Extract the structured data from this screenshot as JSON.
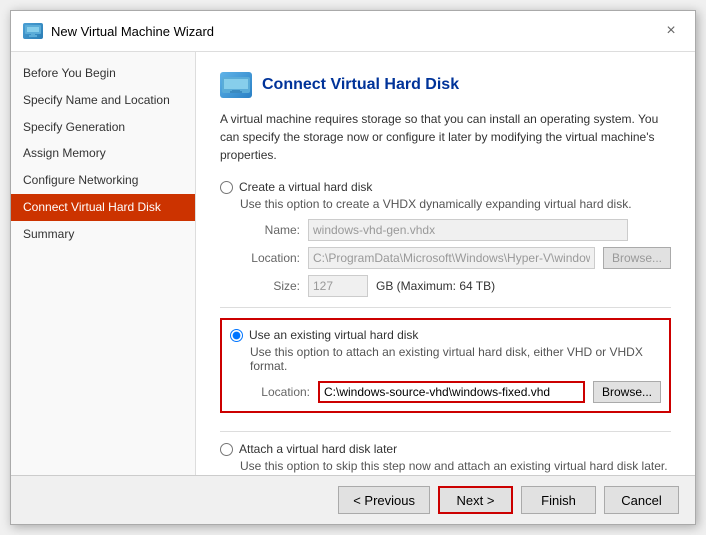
{
  "dialog": {
    "title": "New Virtual Machine Wizard",
    "close_label": "×"
  },
  "sidebar": {
    "items": [
      {
        "label": "Before You Begin",
        "active": false
      },
      {
        "label": "Specify Name and Location",
        "active": false
      },
      {
        "label": "Specify Generation",
        "active": false
      },
      {
        "label": "Assign Memory",
        "active": false
      },
      {
        "label": "Configure Networking",
        "active": false
      },
      {
        "label": "Connect Virtual Hard Disk",
        "active": true
      },
      {
        "label": "Summary",
        "active": false
      }
    ]
  },
  "main": {
    "icon_label": "💾",
    "title": "Connect Virtual Hard Disk",
    "description": "A virtual machine requires storage so that you can install an operating system. You can specify the storage now or configure it later by modifying the virtual machine's properties.",
    "option1": {
      "label": "Create a virtual hard disk",
      "desc": "Use this option to create a VHDX dynamically expanding virtual hard disk.",
      "name_label": "Name:",
      "name_value": "windows-vhd-gen.vhdx",
      "location_label": "Location:",
      "location_value": "C:\\ProgramData\\Microsoft\\Windows\\Hyper-V\\windows-vhd-gen\\Vir",
      "size_label": "Size:",
      "size_value": "127",
      "size_suffix": "GB (Maximum: 64 TB)",
      "browse_label": "Browse..."
    },
    "option2": {
      "label": "Use an existing virtual hard disk",
      "desc": "Use this option to attach an existing virtual hard disk, either VHD or VHDX format.",
      "location_label": "Location:",
      "location_value": "C:\\windows-source-vhd\\windows-fixed.vhd",
      "browse_label": "Browse..."
    },
    "option3": {
      "label": "Attach a virtual hard disk later",
      "desc": "Use this option to skip this step now and attach an existing virtual hard disk later."
    }
  },
  "footer": {
    "previous_label": "< Previous",
    "next_label": "Next >",
    "finish_label": "Finish",
    "cancel_label": "Cancel"
  }
}
